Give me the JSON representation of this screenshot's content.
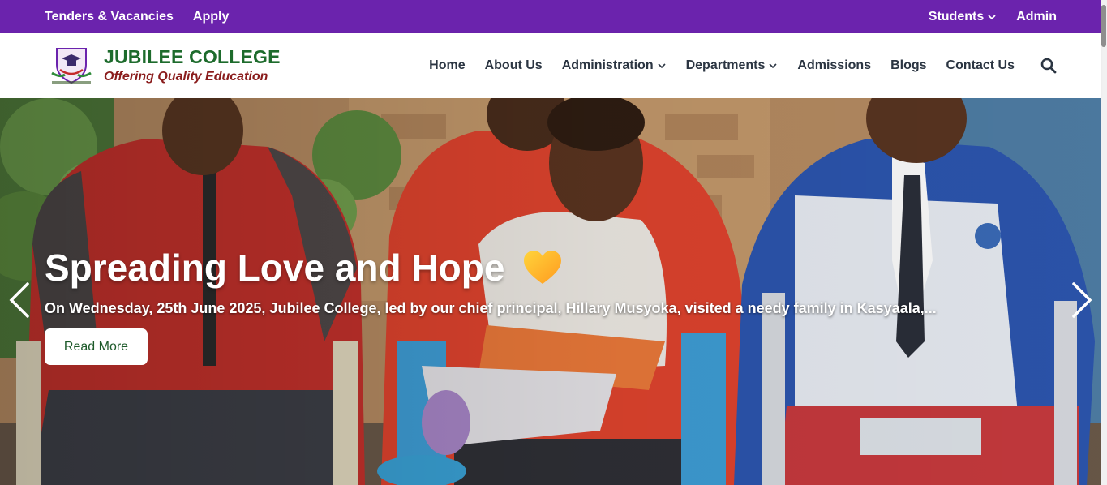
{
  "topbar": {
    "left_links": [
      "Tenders & Vacancies",
      "Apply"
    ],
    "right_links": [
      {
        "label": "Students",
        "icon": "chevron-down-icon"
      },
      {
        "label": "Admin"
      }
    ]
  },
  "header": {
    "brand_name": "JUBILEE COLLEGE",
    "brand_tagline": "Offering Quality Education",
    "nav": [
      {
        "label": "Home"
      },
      {
        "label": "About Us"
      },
      {
        "label": "Administration",
        "icon": "chevron-down-icon"
      },
      {
        "label": "Departments",
        "icon": "chevron-down-icon"
      },
      {
        "label": "Admissions"
      },
      {
        "label": "Blogs"
      },
      {
        "label": "Contact Us"
      }
    ],
    "search_icon": "search-icon"
  },
  "hero": {
    "title": "Spreading Love and Hope",
    "subtitle": "On Wednesday, 25th June 2025, Jubilee College, led by our chief principal, Hillary Musyoka, visited a needy family in Kasyaala,...",
    "button": "Read More",
    "prev_icon": "chevron-left-icon",
    "next_icon": "chevron-right-icon"
  },
  "colors": {
    "topbar": "#6b23ad",
    "brand_green": "#1d6b2c",
    "brand_red": "#8a1c1c",
    "nav_text": "#2b3542"
  }
}
